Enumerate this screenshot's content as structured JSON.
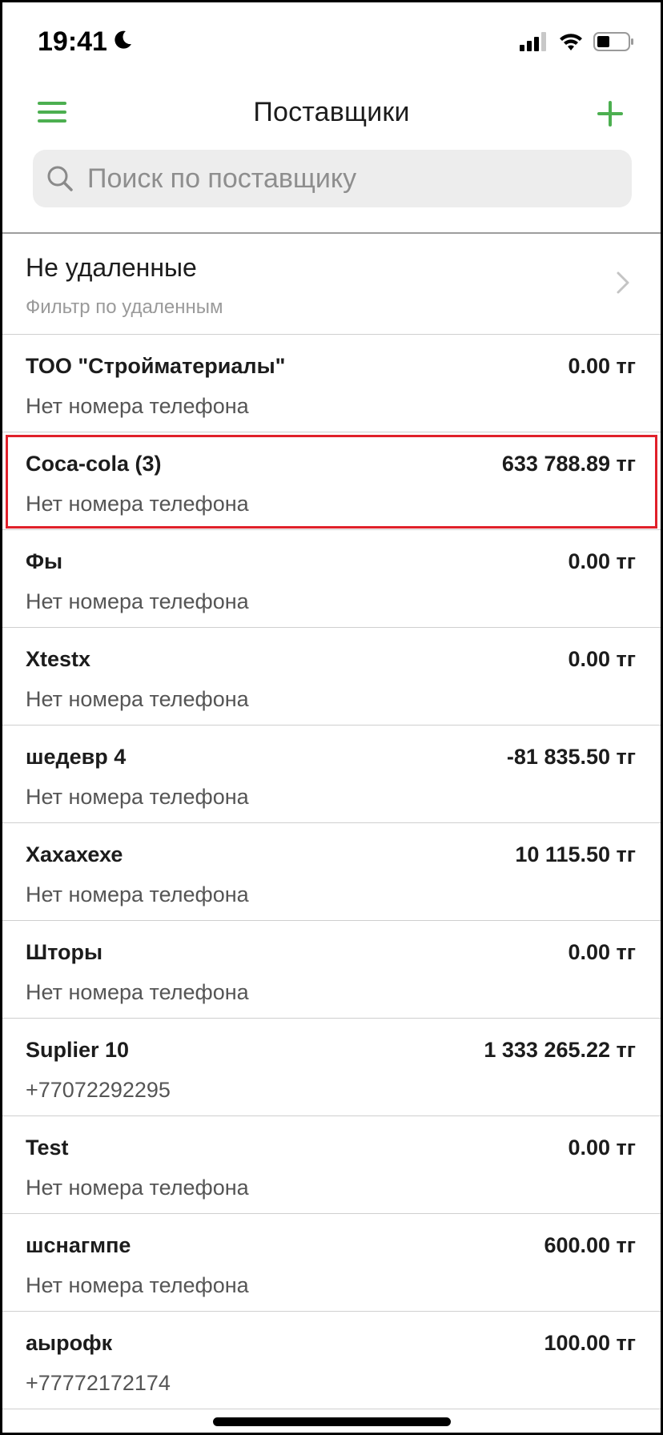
{
  "status_bar": {
    "time": "19:41",
    "icons": [
      "moon-icon",
      "cellular-signal-icon",
      "wifi-icon",
      "battery-icon"
    ]
  },
  "header": {
    "title": "Поставщики",
    "menu_icon": "hamburger-menu-icon",
    "add_icon": "plus-icon"
  },
  "search": {
    "placeholder": "Поиск по поставщику",
    "value": ""
  },
  "filter": {
    "title": "Не удаленные",
    "subtitle": "Фильтр по удаленным"
  },
  "suppliers": [
    {
      "name": "ТОО \"Стройматериалы\"",
      "amount": "0.00 тг",
      "phone": "Нет номера телефона"
    },
    {
      "name": "Coca-cola (3)",
      "amount": "633 788.89 тг",
      "phone": "Нет номера телефона"
    },
    {
      "name": "Фы",
      "amount": "0.00 тг",
      "phone": "Нет номера телефона"
    },
    {
      "name": "Xtestx",
      "amount": "0.00 тг",
      "phone": "Нет номера телефона"
    },
    {
      "name": "шедевр 4",
      "amount": "-81 835.50 тг",
      "phone": "Нет номера телефона"
    },
    {
      "name": "Хахахехе",
      "amount": "10 115.50 тг",
      "phone": "Нет номера телефона"
    },
    {
      "name": "Шторы",
      "amount": "0.00 тг",
      "phone": "Нет номера телефона"
    },
    {
      "name": "Suplier 10",
      "amount": "1 333 265.22 тг",
      "phone": "+77072292295"
    },
    {
      "name": "Test",
      "amount": "0.00 тг",
      "phone": "Нет номера телефона"
    },
    {
      "name": "шснагмпе",
      "amount": "600.00 тг",
      "phone": "Нет номера телефона"
    },
    {
      "name": "аырофк",
      "amount": "100.00 тг",
      "phone": "+77772172174"
    }
  ],
  "colors": {
    "accent": "#4caf50",
    "highlight": "#e0202a"
  }
}
